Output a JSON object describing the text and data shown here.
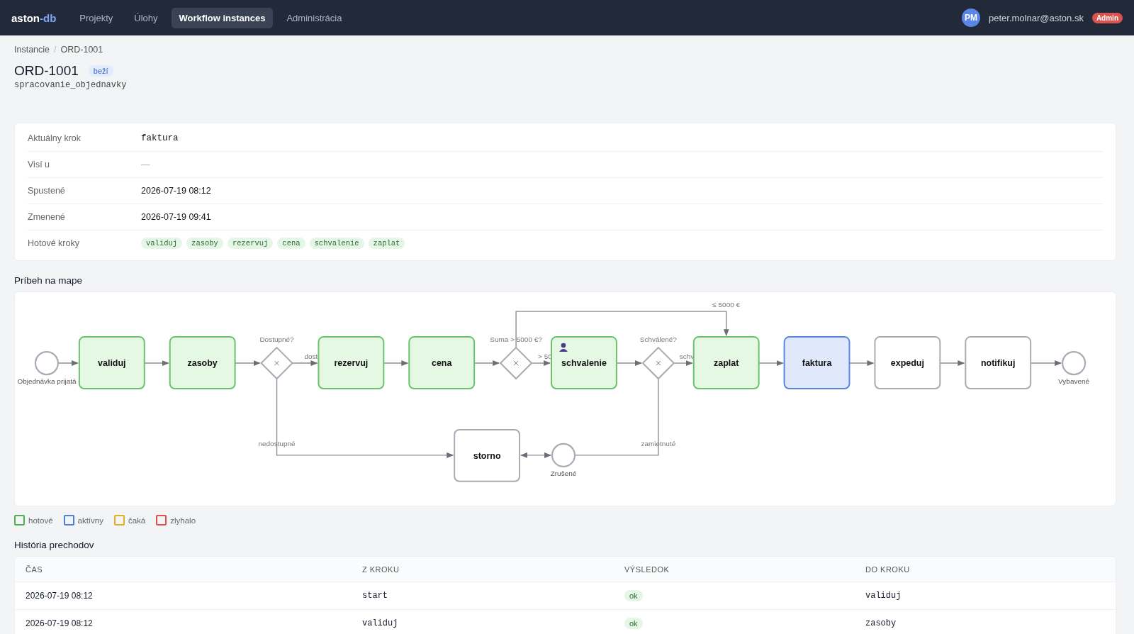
{
  "navbar": {
    "brand": {
      "name": "aston",
      "suffix": "-db"
    },
    "nav_items": [
      {
        "label": "Projekty",
        "selected": false
      },
      {
        "label": "Úlohy",
        "selected": false
      },
      {
        "label": "Workflow instances",
        "selected": true
      },
      {
        "label": "Administrácia",
        "selected": false
      }
    ],
    "user": {
      "initials": "PM",
      "email": "peter.molnar@aston.sk",
      "role": "Admin"
    }
  },
  "breadcrumb": {
    "items": [
      "Instancie",
      "ORD-1001"
    ],
    "separator": "/"
  },
  "header": {
    "title": "ORD-1001",
    "status": "beží",
    "workflow": "spracovanie_objednavky"
  },
  "details": [
    {
      "label": "Aktuálny krok",
      "kind": "mono",
      "value": "faktura"
    },
    {
      "label": "Visí u",
      "kind": "empty",
      "value": "—"
    },
    {
      "label": "Spustené",
      "kind": "text",
      "value": "2026-07-19 08:12"
    },
    {
      "label": "Zmenené",
      "kind": "text",
      "value": "2026-07-19 09:41"
    },
    {
      "label": "Hotové kroky",
      "kind": "tags",
      "tags": [
        "validuj",
        "zasoby",
        "rezervuj",
        "cena",
        "schvalenie",
        "zaplat"
      ]
    }
  ],
  "map": {
    "title": "Príbeh na mape",
    "tasks": [
      {
        "label": "validuj",
        "done": true,
        "active": false,
        "kind": "task"
      },
      {
        "label": "zasoby",
        "done": true,
        "active": false,
        "kind": "task"
      },
      {
        "label": "rezervuj",
        "done": true,
        "active": false,
        "kind": "task"
      },
      {
        "label": "cena",
        "done": true,
        "active": false,
        "kind": "task"
      },
      {
        "label": "schvalenie",
        "done": true,
        "active": false,
        "kind": "user"
      },
      {
        "label": "zaplat",
        "done": true,
        "active": false,
        "kind": "task"
      },
      {
        "label": "faktura",
        "done": false,
        "active": true,
        "kind": "task"
      },
      {
        "label": "expeduj",
        "done": false,
        "active": false,
        "kind": "task"
      },
      {
        "label": "notifikuj",
        "done": false,
        "active": false,
        "kind": "task"
      },
      {
        "label": "storno",
        "done": false,
        "active": false,
        "kind": "task"
      }
    ],
    "gateways": [
      {
        "label": "Dostupné?"
      },
      {
        "label": "Suma > 5000 €?"
      },
      {
        "label": "Schválené?"
      }
    ],
    "events": [
      {
        "label": "Objednávka prijatá"
      },
      {
        "label": "Zrušené"
      },
      {
        "label": "Vybavené"
      }
    ],
    "edge_labels": [
      "dost",
      "> 50",
      "schv",
      "≤ 5000 €",
      "nedostupné",
      "zamietnuté"
    ]
  },
  "legend": [
    {
      "label": "hotové",
      "color": "#4caf50"
    },
    {
      "label": "aktívny",
      "color": "#4a7fe0"
    },
    {
      "label": "čaká",
      "color": "#e0b020"
    },
    {
      "label": "zlyhalo",
      "color": "#e05050"
    }
  ],
  "history": {
    "title": "História prechodov",
    "columns": [
      "ČAS",
      "Z KROKU",
      "VÝSLEDOK",
      "DO KROKU"
    ],
    "rows": [
      {
        "time": "2026-07-19 08:12",
        "from": "start",
        "result": "ok",
        "to": "validuj"
      },
      {
        "time": "2026-07-19 08:12",
        "from": "validuj",
        "result": "ok",
        "to": "zasoby"
      }
    ]
  }
}
